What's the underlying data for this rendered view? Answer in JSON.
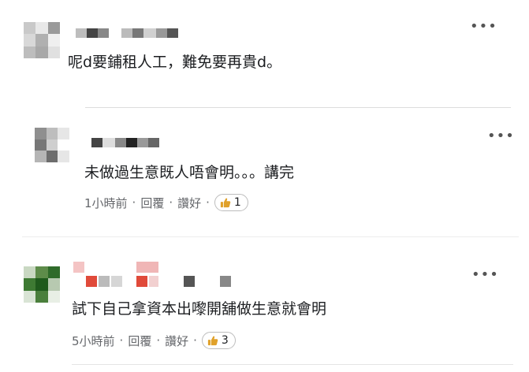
{
  "comments": [
    {
      "avatar_colors": [
        "#c9c9c9",
        "#e8e8e8",
        "#9a9a9a",
        "#d8d8d8",
        "#b0b0b0",
        "#efefef"
      ],
      "name_colors": [
        "#bdbdbd",
        "#444444",
        "#888888",
        "#ffffff",
        "#bbbbbb",
        "#777777",
        "#d0d0d0",
        "#999999",
        "#555555"
      ],
      "text": "呢d要鋪租人工，難免要再貴d。"
    },
    {
      "avatar_colors": [
        "#8f8f8f",
        "#bdbdbd",
        "#e6e6e6",
        "#777777",
        "#cfcfcf",
        "#ffffff"
      ],
      "name_colors": [
        "#444444",
        "#dddddd",
        "#888888",
        "#222222",
        "#999999",
        "#666666"
      ],
      "text": "未做過生意既人唔會明。。。講完",
      "time": "1小時前",
      "reply_label": "回覆",
      "like_label": "讚好",
      "sep": "·",
      "likes": "1"
    },
    {
      "avatar_colors": [
        "#5e8c4a",
        "#2f6b2a",
        "#b7c9b0",
        "#3e7a33",
        "#d9e4d5",
        "#1f5a1c"
      ],
      "name_colors": [
        "#f4c4c4",
        "#ffffff",
        "#e04a3a",
        "#bbbbbb",
        "#ffffff",
        "#e04a3a",
        "#ffffff",
        "#555555",
        "#ffffff",
        "#888888"
      ],
      "text": "試下自己拿資本出嚟開舖做生意就會明",
      "time": "5小時前",
      "reply_label": "回覆",
      "like_label": "讚好",
      "sep": "·",
      "likes": "3"
    }
  ],
  "ui": {
    "more_glyph": "•••",
    "like_color": "#e0a12a"
  }
}
